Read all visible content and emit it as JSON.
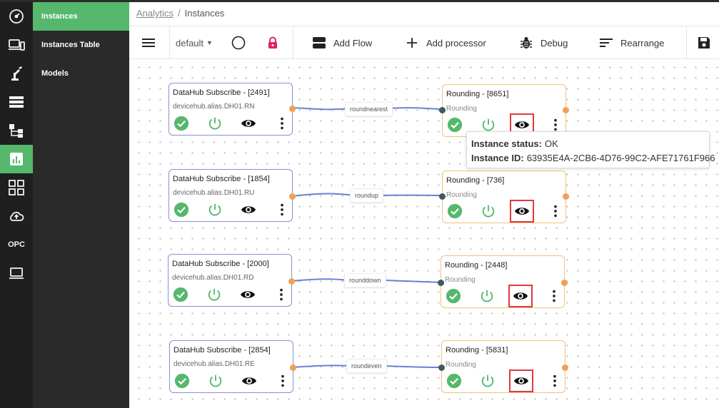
{
  "rail": {
    "items": [
      {
        "icon": "dashboard-gauge-icon"
      },
      {
        "icon": "devices-icon"
      },
      {
        "icon": "robot-arm-icon"
      },
      {
        "icon": "server-list-icon"
      },
      {
        "icon": "flow-hierarchy-icon"
      },
      {
        "icon": "analytics-chart-icon",
        "active": true
      },
      {
        "icon": "apps-grid-icon"
      },
      {
        "icon": "cloud-upload-icon"
      },
      {
        "text": "OPC"
      },
      {
        "icon": "laptop-icon"
      }
    ]
  },
  "submenu": {
    "items": [
      {
        "label": "Instances",
        "active": true
      },
      {
        "label": "Instances Table"
      },
      {
        "label": "Models"
      }
    ]
  },
  "breadcrumb": {
    "parent": "Analytics",
    "current": "Instances"
  },
  "toolbar": {
    "workspace": "default",
    "add_flow": "Add Flow",
    "add_processor": "Add processor",
    "debug": "Debug",
    "rearrange": "Rearrange"
  },
  "flows": [
    {
      "subscribe": {
        "title": "DataHub Subscribe - [2491]",
        "alias": "devicehub.alias.DH01.RN"
      },
      "edge_label": "roundnearest",
      "processor": {
        "title": "Rounding - [8651]",
        "type": "Rounding"
      }
    },
    {
      "subscribe": {
        "title": "DataHub Subscribe - [1854]",
        "alias": "devicehub.alias.DH01.RU"
      },
      "edge_label": "roundup",
      "processor": {
        "title": "Rounding - [736]",
        "type": "Rounding"
      }
    },
    {
      "subscribe": {
        "title": "DataHub Subscribe - [2000]",
        "alias": "devicehub.alias.DH01.RD"
      },
      "edge_label": "rounddown",
      "processor": {
        "title": "Rounding - [2448]",
        "type": "Rounding"
      }
    },
    {
      "subscribe": {
        "title": "DataHub Subscribe - [2854]",
        "alias": "devicehub.alias.DH01.RE"
      },
      "edge_label": "roundeven",
      "processor": {
        "title": "Rounding - [5831]",
        "type": "Rounding"
      }
    }
  ],
  "tooltip": {
    "status_label": "Instance status:",
    "status_value": "OK",
    "id_label": "Instance ID:",
    "id_value": "63935E4A-2CB6-4D76-99C2-AFE71761F966"
  },
  "colors": {
    "accent_green": "#55b86d",
    "lock_red": "#e0245e",
    "edge_blue": "#6b7fd7",
    "highlight_red": "#e0393e"
  }
}
